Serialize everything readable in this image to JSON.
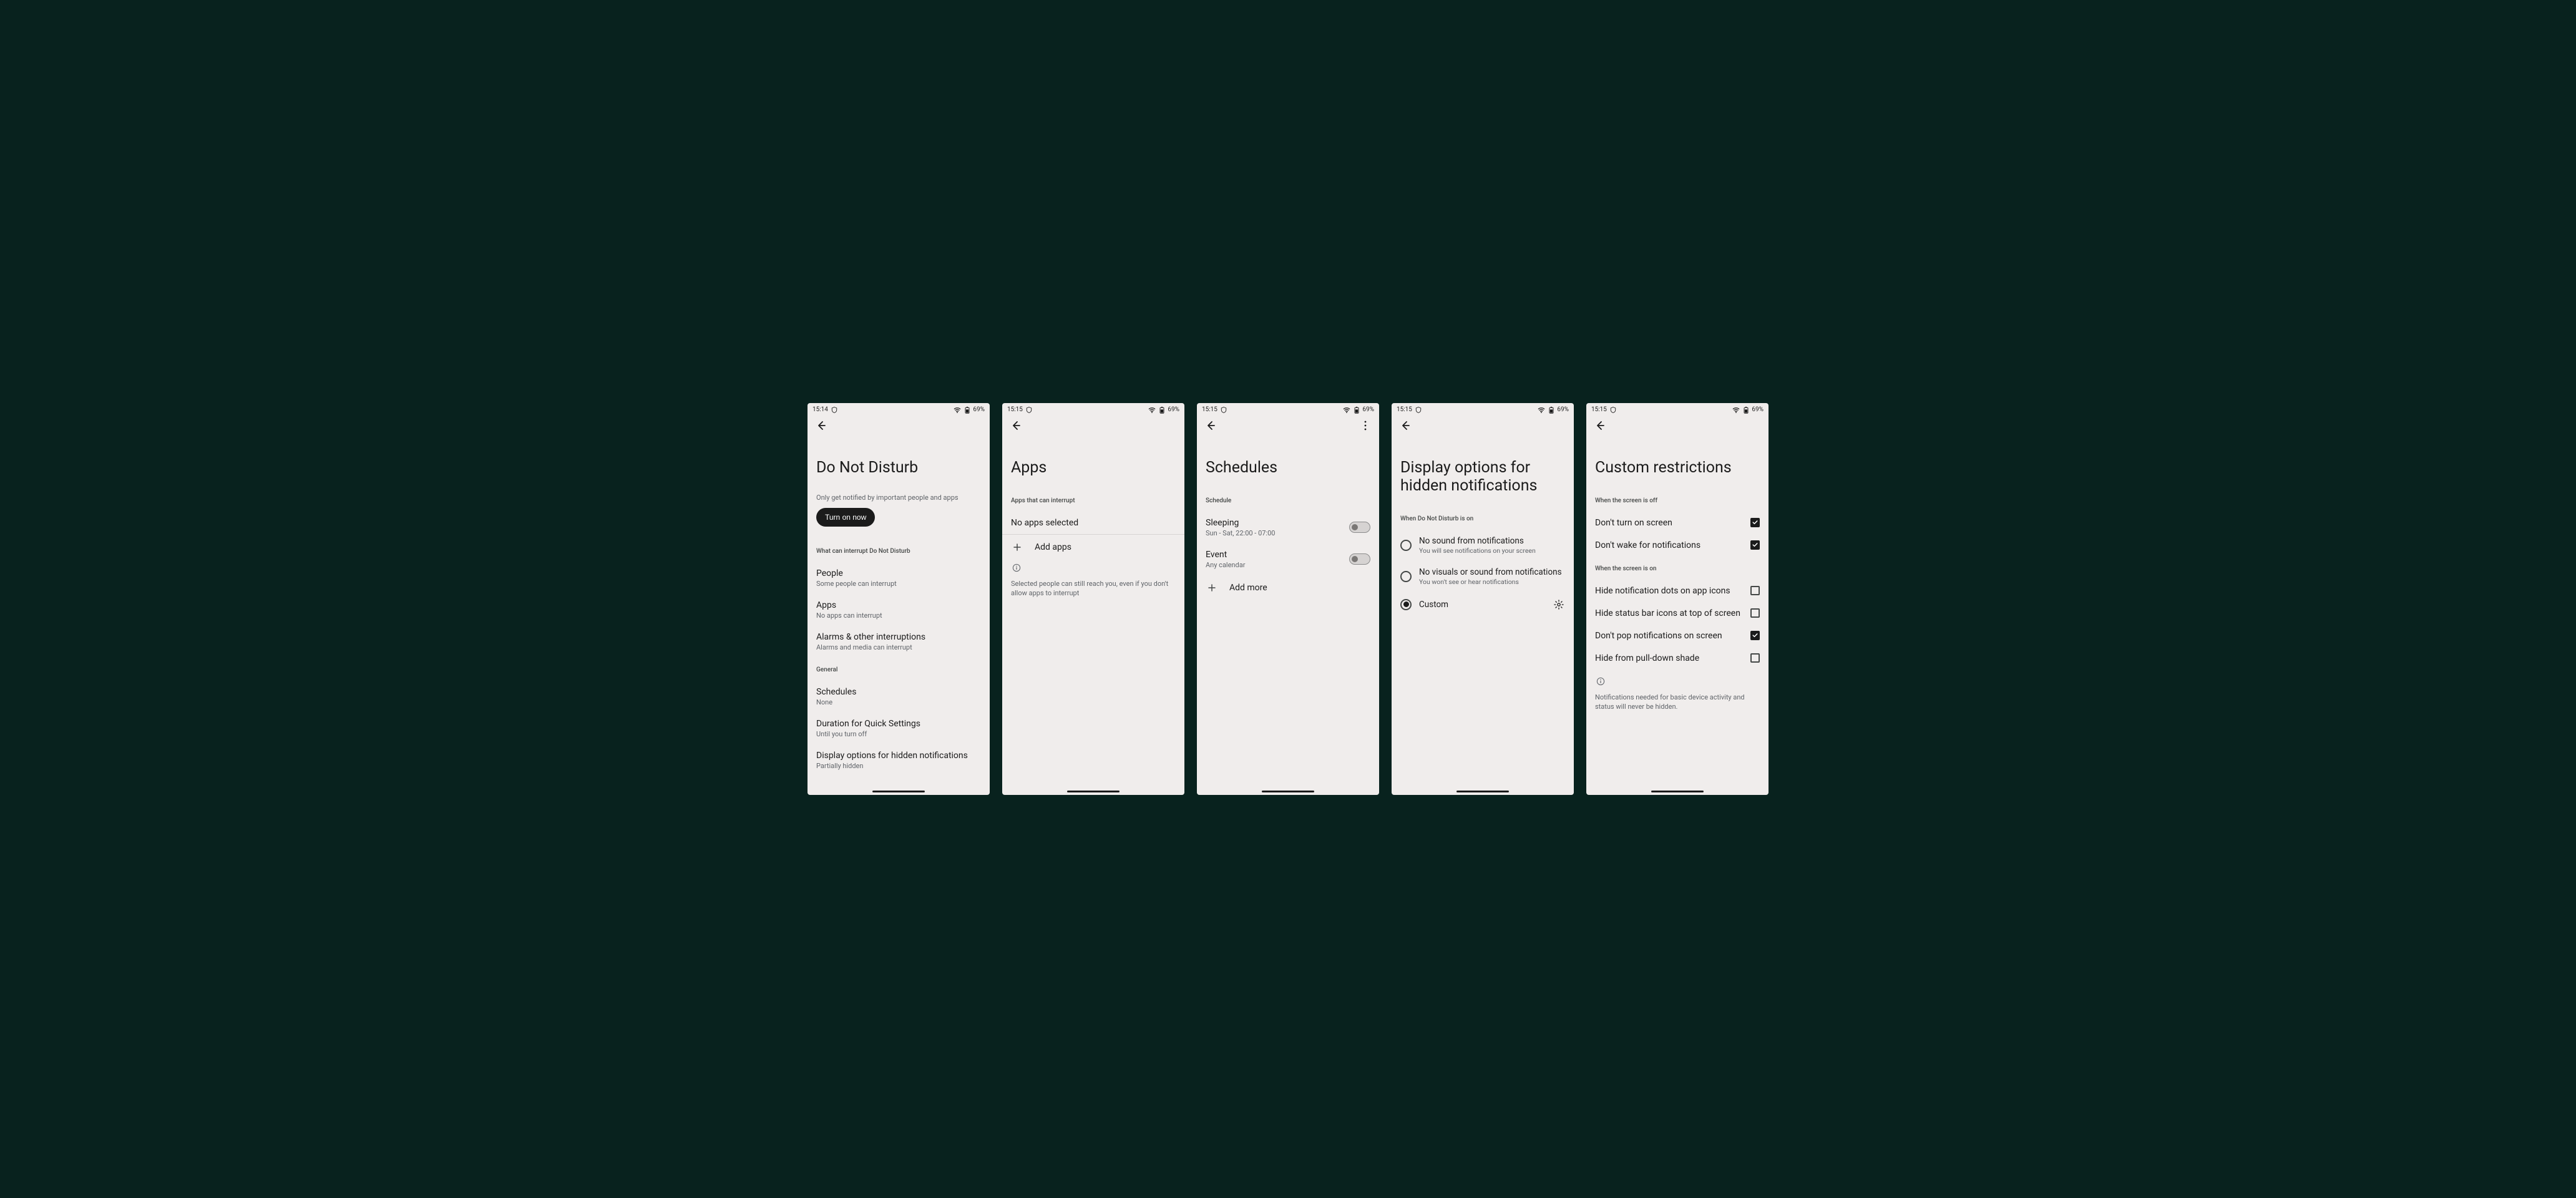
{
  "status": {
    "battery_pct": "69%"
  },
  "screen1": {
    "time": "15:14",
    "title": "Do Not Disturb",
    "subtitle": "Only get notified by important people and apps",
    "turn_on": "Turn on now",
    "section_interrupt": "What can interrupt Do Not Disturb",
    "people": {
      "title": "People",
      "sub": "Some people can interrupt"
    },
    "apps": {
      "title": "Apps",
      "sub": "No apps can interrupt"
    },
    "alarms": {
      "title": "Alarms & other interruptions",
      "sub": "Alarms and media can interrupt"
    },
    "section_general": "General",
    "schedules": {
      "title": "Schedules",
      "sub": "None"
    },
    "duration": {
      "title": "Duration for Quick Settings",
      "sub": "Until you turn off"
    },
    "display": {
      "title": "Display options for hidden notifications",
      "sub": "Partially hidden"
    }
  },
  "screen2": {
    "time": "15:15",
    "title": "Apps",
    "section": "Apps that can interrupt",
    "no_apps": "No apps selected",
    "add_apps": "Add apps",
    "info": "Selected people can still reach you, even if you don't allow apps to interrupt"
  },
  "screen3": {
    "time": "15:15",
    "title": "Schedules",
    "section": "Schedule",
    "sleeping": {
      "title": "Sleeping",
      "sub": "Sun - Sat, 22:00 - 07:00"
    },
    "event": {
      "title": "Event",
      "sub": "Any calendar"
    },
    "add_more": "Add more"
  },
  "screen4": {
    "time": "15:15",
    "title": "Display options for hidden notifications",
    "section": "When Do Not Disturb is on",
    "opt1": {
      "title": "No sound from notifications",
      "sub": "You will see notifications on your screen"
    },
    "opt2": {
      "title": "No visuals or sound from notifications",
      "sub": "You won't see or hear notifications"
    },
    "opt3": {
      "title": "Custom"
    }
  },
  "screen5": {
    "time": "15:15",
    "title": "Custom restrictions",
    "section_off": "When the screen is off",
    "off1": "Don't turn on screen",
    "off2": "Don't wake for notifications",
    "section_on": "When the screen is on",
    "on1": "Hide notification dots on app icons",
    "on2": "Hide status bar icons at top of screen",
    "on3": "Don't pop notifications on screen",
    "on4": "Hide from pull-down shade",
    "info": "Notifications needed for basic device activity and status will never be hidden."
  }
}
